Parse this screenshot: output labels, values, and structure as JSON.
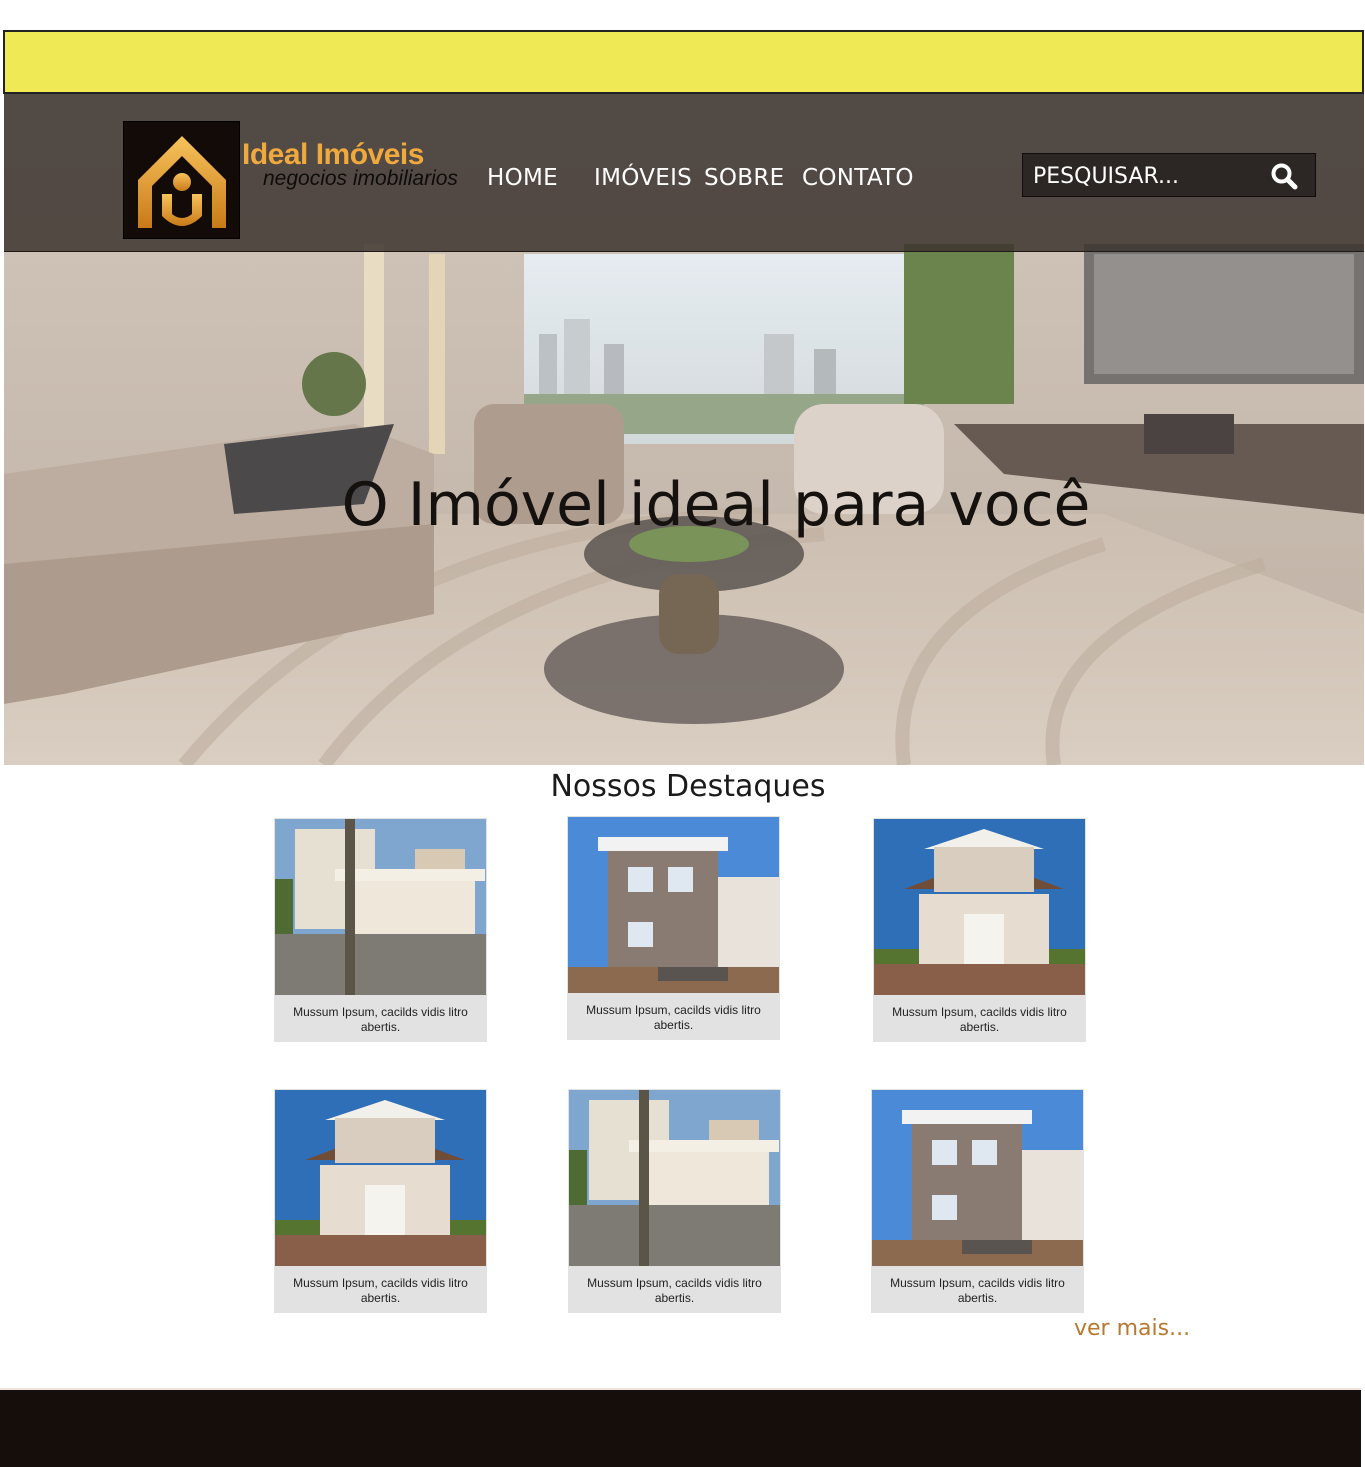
{
  "brand": {
    "name": "Ideal Imóveis",
    "tagline": "negocios imobiliarios"
  },
  "nav": {
    "items": [
      "HOME",
      "IMÓVEIS",
      "SOBRE",
      "CONTATO"
    ]
  },
  "search": {
    "placeholder": "PESQUISAR..."
  },
  "hero": {
    "title": "O Imóvel ideal para você"
  },
  "featured": {
    "title": "Nossos Destaques",
    "cards": [
      {
        "caption": "Mussum Ipsum, cacilds vidis litro abertis.",
        "photo": "condominium-gate-photo"
      },
      {
        "caption": "Mussum Ipsum, cacilds vidis litro abertis.",
        "photo": "modern-house-photo"
      },
      {
        "caption": "Mussum Ipsum, cacilds vidis litro abertis.",
        "photo": "two-story-house-photo"
      },
      {
        "caption": "Mussum Ipsum, cacilds vidis litro abertis.",
        "photo": "two-story-house-photo"
      },
      {
        "caption": "Mussum Ipsum, cacilds vidis litro abertis.",
        "photo": "condominium-gate-photo"
      },
      {
        "caption": "Mussum Ipsum, cacilds vidis litro abertis.",
        "photo": "modern-house-photo"
      }
    ],
    "more_label": "ver mais..."
  },
  "colors": {
    "top_bar": "#efe955",
    "header_overlay": "#3c342f",
    "logo_gold": "#f0a93d",
    "link_accent": "#b8792d",
    "footer": "#150e0a"
  }
}
